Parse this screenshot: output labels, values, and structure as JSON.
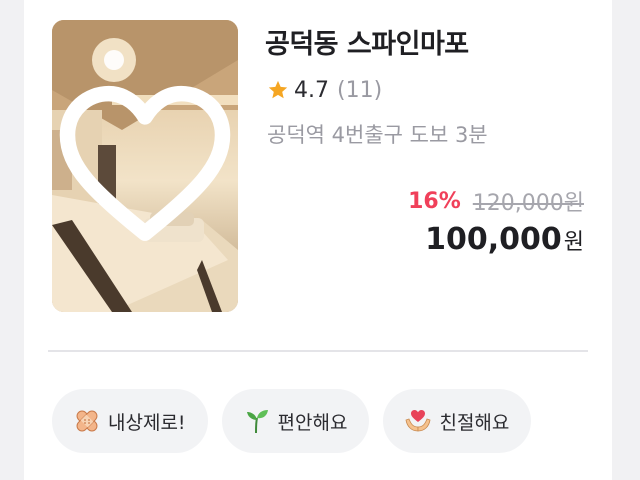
{
  "listing": {
    "title": "공덕동 스파인마포",
    "rating": "4.7",
    "review_count": "(11)",
    "location": "공덕역 4번출구 도보 3분",
    "discount": "16%",
    "original_price": "120,000원",
    "price": "100,000",
    "currency": "원",
    "favorite": false
  },
  "tags": [
    {
      "label": "내상제로!",
      "icon": "bandage-icon"
    },
    {
      "label": "편안해요",
      "icon": "sprout-icon"
    },
    {
      "label": "친절해요",
      "icon": "heart-hands-icon"
    }
  ],
  "colors": {
    "discount": "#f0405a",
    "star": "#f5a623",
    "text": "#1f1f23",
    "muted": "#9a9aa2"
  }
}
